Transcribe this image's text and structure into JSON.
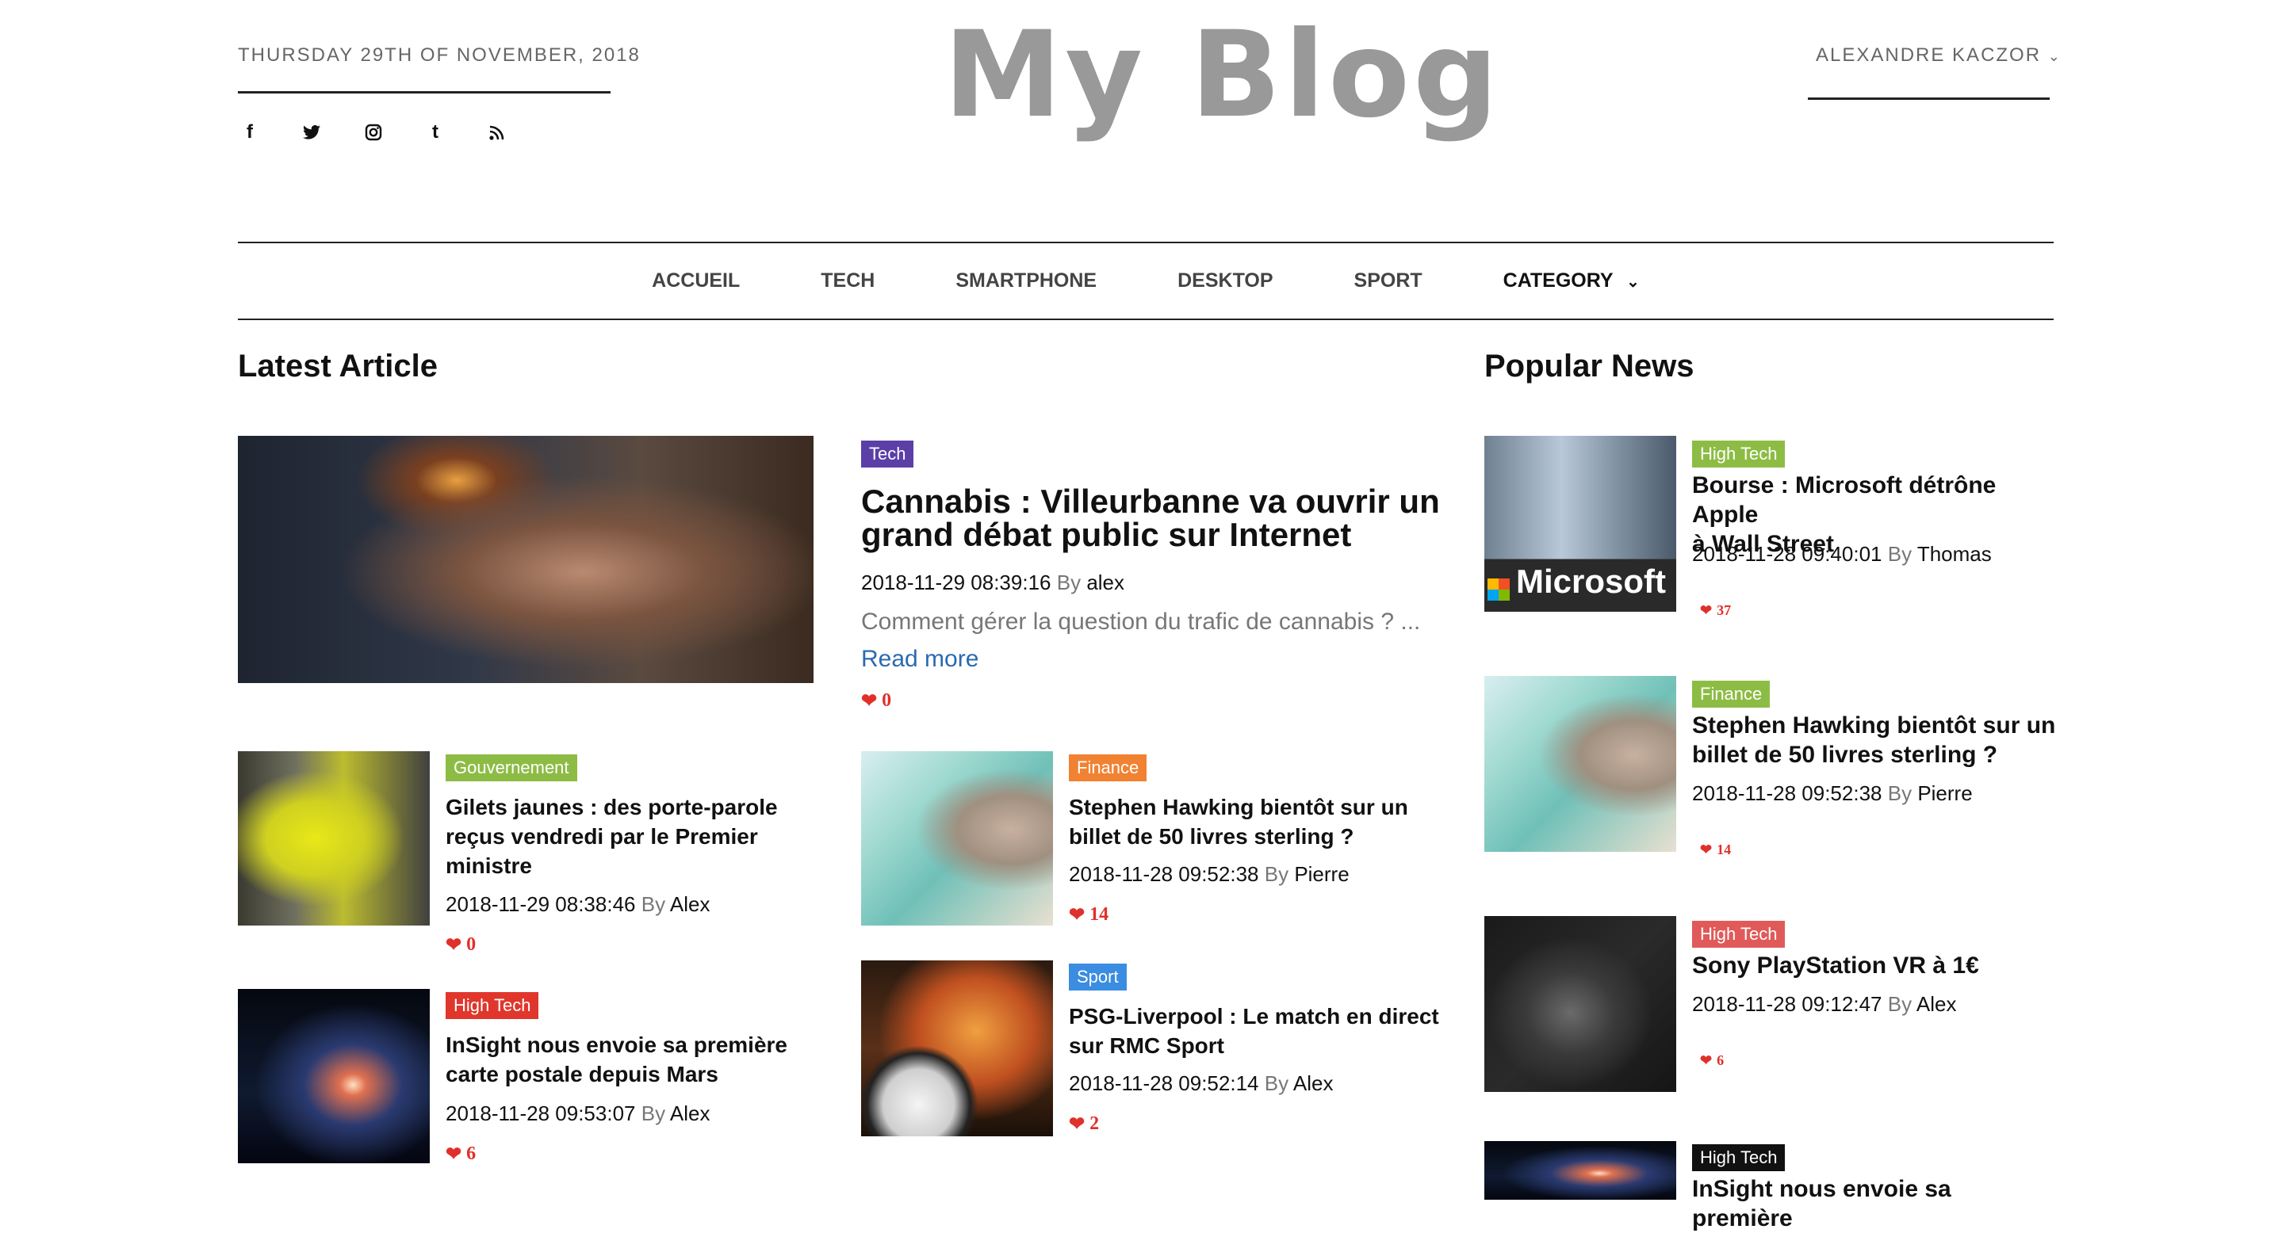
{
  "header": {
    "date": "THURSDAY 29TH OF NOVEMBER, 2018",
    "logo": "My Blog",
    "user": "ALEXANDRE KACZOR",
    "social": [
      {
        "icon": "facebook-icon",
        "glyph": "f"
      },
      {
        "icon": "twitter-icon",
        "glyph": "🐦"
      },
      {
        "icon": "instagram-icon",
        "glyph": "◎"
      },
      {
        "icon": "tumblr-icon",
        "glyph": "t"
      },
      {
        "icon": "rss-icon",
        "glyph": "⋰"
      }
    ]
  },
  "nav": {
    "items": [
      "ACCUEIL",
      "TECH",
      "SMARTPHONE",
      "DESKTOP",
      "SPORT",
      "CATEGORY"
    ]
  },
  "latest": {
    "heading": "Latest Article",
    "featured": {
      "tag": "Tech",
      "tag_color": "#5b3fa7",
      "title_line1": "Cannabis : Villeurbanne va ouvrir un",
      "title_line2": "grand débat public sur Internet",
      "date": "2018-11-29 08:39:16",
      "by": "By",
      "author": "alex",
      "excerpt": "Comment gérer la question du trafic de cannabis ? ...",
      "read_more": "Read more",
      "likes": "0"
    },
    "items": [
      {
        "tag": "Gouvernement",
        "tag_color": "#8dbc45",
        "line1": "Gilets jaunes : des porte-parole",
        "line2": "reçus vendredi par le Premier",
        "line3": "ministre",
        "date": "2018-11-29 08:38:46",
        "by": "By",
        "author": "Alex",
        "likes": "0"
      },
      {
        "tag": "Finance",
        "tag_color": "#f08232",
        "line1": "Stephen Hawking bientôt sur un",
        "line2": "billet de 50 livres sterling ?",
        "date": "2018-11-28 09:52:38",
        "by": "By",
        "author": "Pierre",
        "likes": "14"
      },
      {
        "tag": "High Tech",
        "tag_color": "#e0362c",
        "line1": "InSight nous envoie sa première",
        "line2": "carte postale depuis Mars",
        "date": "2018-11-28 09:53:07",
        "by": "By",
        "author": "Alex",
        "likes": "6"
      },
      {
        "tag": "Sport",
        "tag_color": "#3a8de0",
        "line1": "PSG-Liverpool : Le match en direct",
        "line2": "sur RMC Sport",
        "date": "2018-11-28 09:52:14",
        "by": "By",
        "author": "Alex",
        "likes": "2"
      }
    ]
  },
  "popular": {
    "heading": "Popular News",
    "items": [
      {
        "tag": "High Tech",
        "tag_color": "#8dbc45",
        "line1": "Bourse : Microsoft détrône Apple",
        "line2": "à Wall Street",
        "date": "2018-11-28 09:40:01",
        "by": "By",
        "author": "Thomas",
        "likes": "37",
        "image_text": "Microsoft"
      },
      {
        "tag": "Finance",
        "tag_color": "#8dbc45",
        "line1": "Stephen Hawking bientôt sur un",
        "line2": "billet de 50 livres sterling ?",
        "date": "2018-11-28 09:52:38",
        "by": "By",
        "author": "Pierre",
        "likes": "14"
      },
      {
        "tag": "High Tech",
        "tag_color": "#e05a5a",
        "line1": "Sony PlayStation VR à 1€",
        "date": "2018-11-28 09:12:47",
        "by": "By",
        "author": "Alex",
        "likes": "6"
      },
      {
        "tag": "High Tech",
        "tag_color": "#111111",
        "line1": "InSight nous envoie sa première"
      }
    ]
  }
}
